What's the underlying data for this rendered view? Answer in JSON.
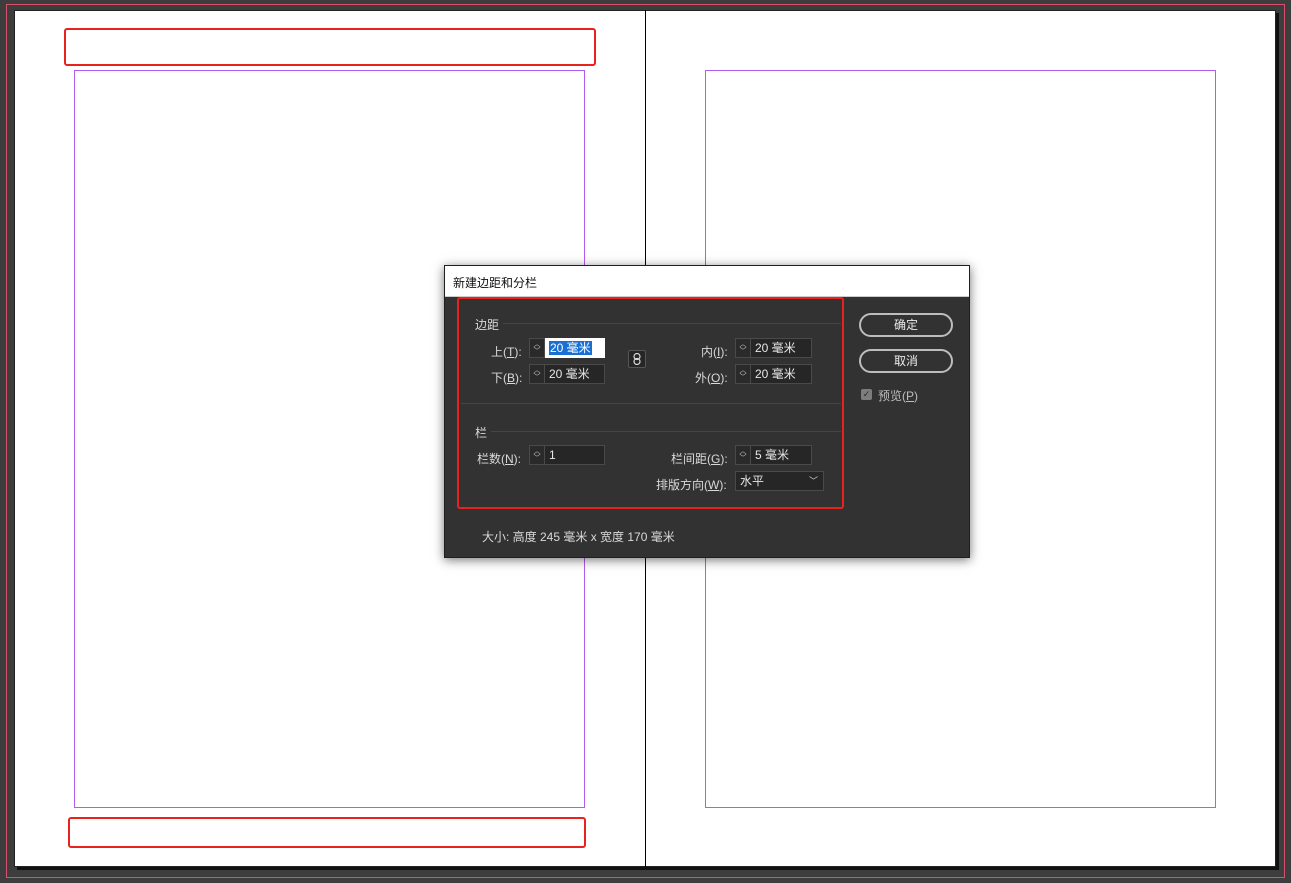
{
  "dialog": {
    "title": "新建边距和分栏",
    "margins": {
      "heading": "边距",
      "top": {
        "label": "上(",
        "key": "T",
        "end": "):",
        "value": "20 毫米"
      },
      "bottom": {
        "label": "下(",
        "key": "B",
        "end": "):",
        "value": "20 毫米"
      },
      "inside": {
        "label": "内(",
        "key": "I",
        "end": "):",
        "value": "20 毫米"
      },
      "outside": {
        "label": "外(",
        "key": "O",
        "end": "):",
        "value": "20 毫米"
      }
    },
    "columns": {
      "heading": "栏",
      "number": {
        "label": "栏数(",
        "key": "N",
        "end": "):",
        "value": "1"
      },
      "gutter": {
        "label": "栏间距(",
        "key": "G",
        "end": "):",
        "value": "5 毫米"
      },
      "writing_direction": {
        "label": "排版方向(",
        "key": "W",
        "end": "):",
        "value": "水平"
      }
    },
    "size_text": "大小:  高度 245 毫米 x 宽度 170 毫米",
    "ok_label": "确定",
    "cancel_label": "取消",
    "preview": {
      "label": "预览(",
      "key": "P",
      "end": ")",
      "checked": true
    }
  },
  "colors": {
    "margin_guide": "#b25cf0",
    "highlight": "#e8231e",
    "dialog_bg": "#323232",
    "selection": "#1a6fd3"
  },
  "icons": {
    "link": "chain-link-icon",
    "spin": "up-down-arrows-icon",
    "dropdown": "chevron-down-icon",
    "check": "check-icon"
  }
}
